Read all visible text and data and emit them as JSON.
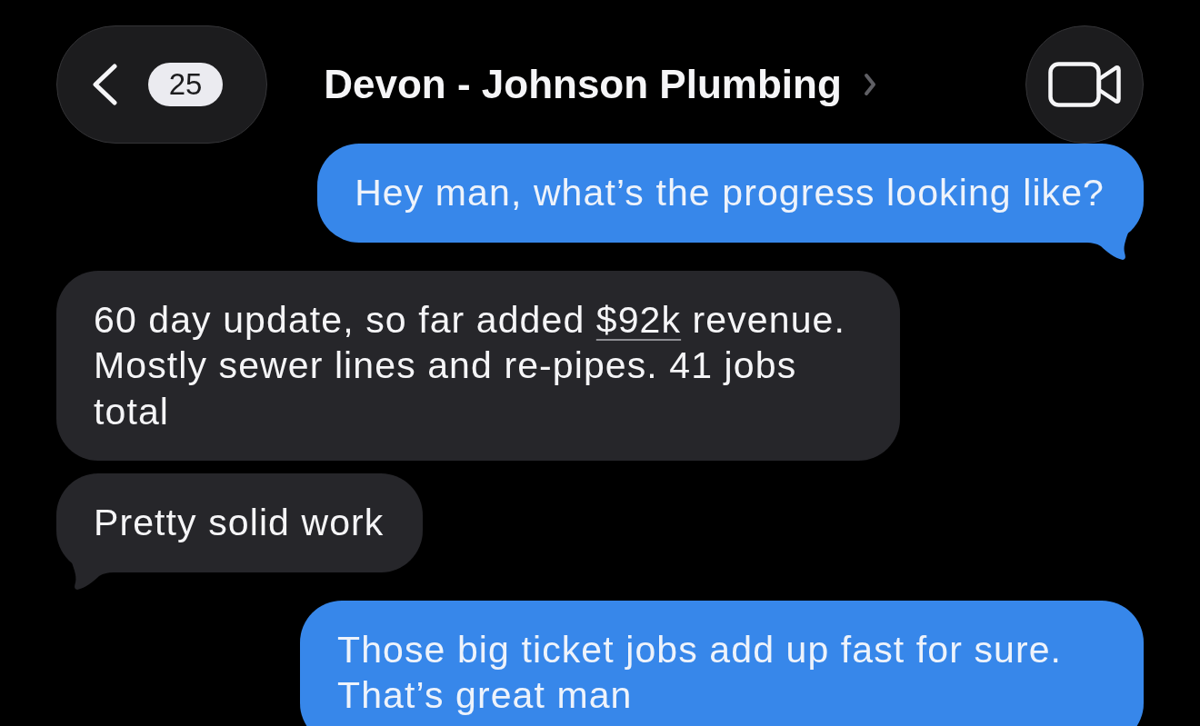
{
  "header": {
    "back_button": {
      "badge": "25"
    },
    "contact": {
      "name": "Devon - Johnson Plumbing"
    }
  },
  "messages": [
    {
      "kind": "outgoing",
      "tail": true,
      "segments": [
        {
          "kind": "text",
          "text": "Hey man, what’s the progress looking like?"
        }
      ]
    },
    {
      "kind": "incoming",
      "tail": false,
      "segments": [
        {
          "kind": "text",
          "text": "60 day update, so far added "
        },
        {
          "kind": "link",
          "text": "$92k"
        },
        {
          "kind": "text",
          "text": " revenue. Mostly sewer lines and re-pipes. 41 jobs total"
        }
      ]
    },
    {
      "kind": "incoming",
      "tail": true,
      "segments": [
        {
          "kind": "text",
          "text": "Pretty solid work"
        }
      ]
    },
    {
      "kind": "outgoing",
      "segments": [
        {
          "kind": "text",
          "text": "Those big ticket jobs add up fast for sure. That’s great man"
        }
      ]
    }
  ]
}
